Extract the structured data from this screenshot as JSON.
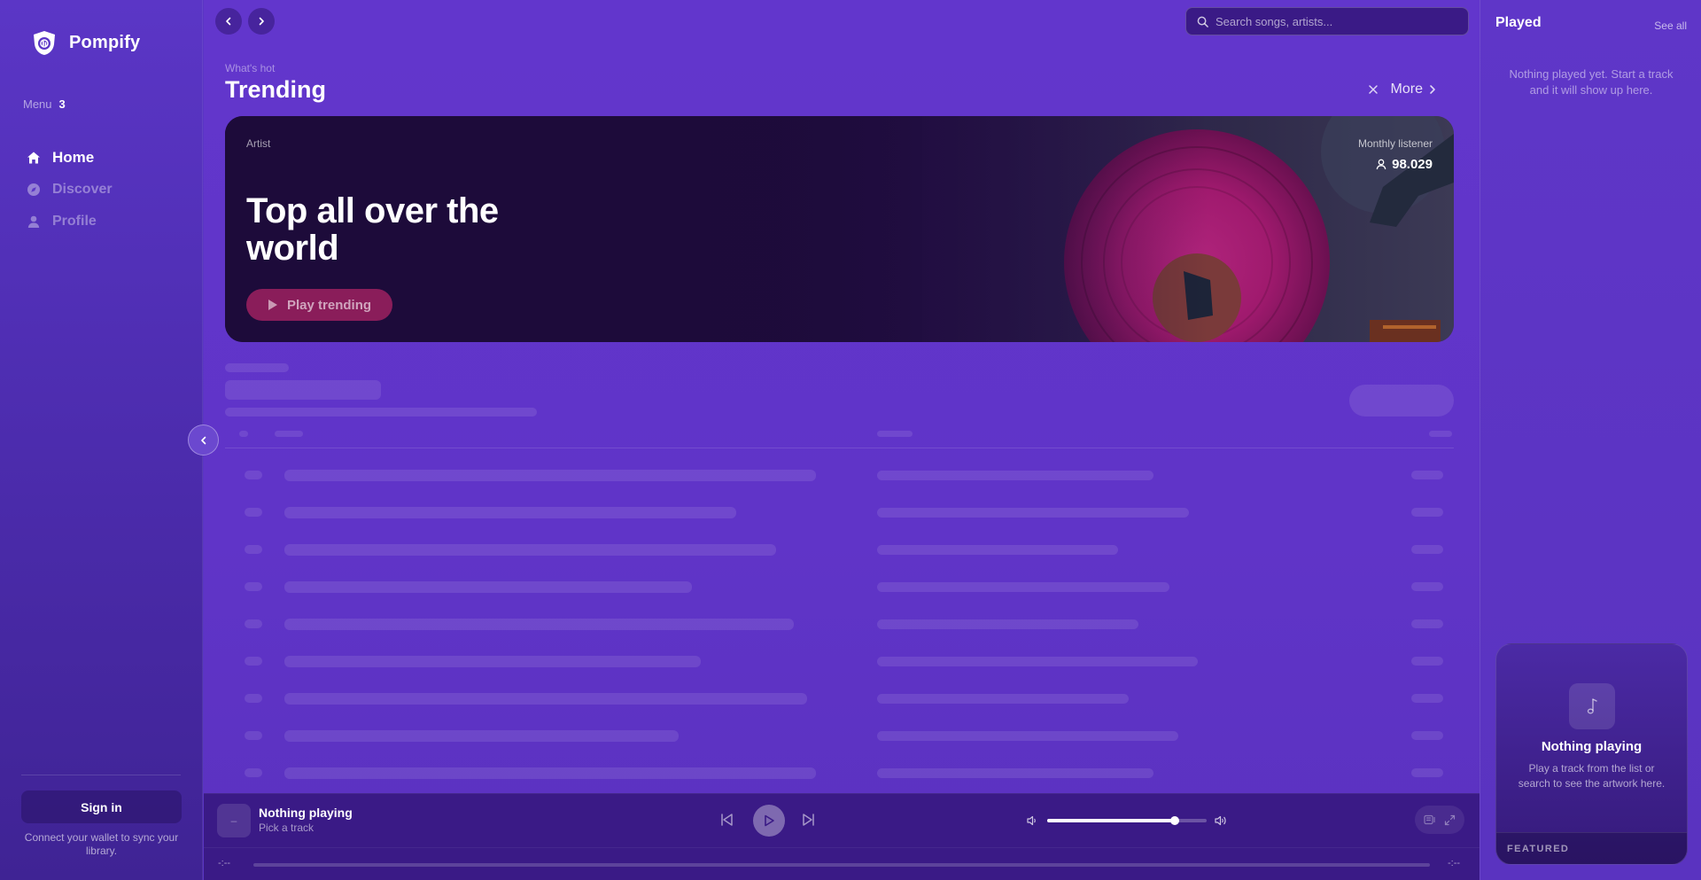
{
  "app": {
    "name": "Pompify"
  },
  "sidebar": {
    "menu_label": "Menu",
    "menu_count": "3",
    "items": [
      {
        "label": "Home",
        "icon": "home-icon",
        "active": true
      },
      {
        "label": "Discover",
        "icon": "compass-icon",
        "active": false
      },
      {
        "label": "Profile",
        "icon": "user-icon",
        "active": false
      }
    ],
    "signin_label": "Sign in",
    "signin_note": "Connect your wallet to sync your library."
  },
  "search": {
    "placeholder": "Search songs, artists..."
  },
  "section": {
    "kicker": "What's hot",
    "title": "Trending",
    "more_label": "More"
  },
  "hero": {
    "label": "Artist",
    "title": "Top all over the world",
    "play_label": "Play trending",
    "listener_label": "Monthly listener",
    "listener_value": "98.029"
  },
  "player": {
    "title": "Nothing playing",
    "subtitle": "Pick a track",
    "thumb_text": "–",
    "time_current": "-:--",
    "time_total": "-:--",
    "volume": 0.8
  },
  "right_panel": {
    "title": "Played",
    "see_all": "See all",
    "empty_text": "Nothing played yet. Start a track and it will show up here.",
    "card_title": "Nothing playing",
    "card_text": "Play a track from the list or search to see the artwork here.",
    "featured_label": "FEATURED"
  },
  "colors": {
    "accent": "#6236cc",
    "sidebar": "#4f2eb3",
    "player_bg": "#3a1a86",
    "hero_play": "#8a1d5a"
  }
}
